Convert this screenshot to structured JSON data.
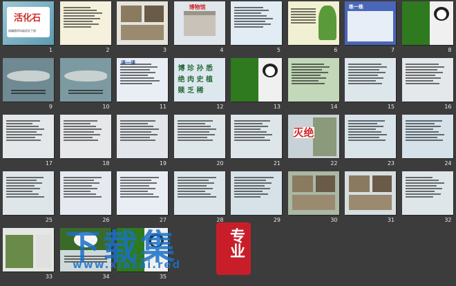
{
  "slides": [
    {
      "n": "1",
      "title": "活化石",
      "sub": "部编版四年级语文下册"
    },
    {
      "n": "2"
    },
    {
      "n": "3"
    },
    {
      "n": "4",
      "title": "博物馆"
    },
    {
      "n": "5"
    },
    {
      "n": "6"
    },
    {
      "n": "7",
      "title": "练一练"
    },
    {
      "n": "8"
    },
    {
      "n": "9"
    },
    {
      "n": "10"
    },
    {
      "n": "11",
      "title": "读一读"
    },
    {
      "n": "12",
      "chars": "博 珍 孙 悉 绝 肉 史 植 赎 乏 稀"
    },
    {
      "n": "13"
    },
    {
      "n": "14"
    },
    {
      "n": "15"
    },
    {
      "n": "16"
    },
    {
      "n": "17"
    },
    {
      "n": "18"
    },
    {
      "n": "19"
    },
    {
      "n": "20"
    },
    {
      "n": "21"
    },
    {
      "n": "22",
      "title": "灭绝"
    },
    {
      "n": "23"
    },
    {
      "n": "24"
    },
    {
      "n": "25"
    },
    {
      "n": "26"
    },
    {
      "n": "27"
    },
    {
      "n": "28"
    },
    {
      "n": "29"
    },
    {
      "n": "30"
    },
    {
      "n": "31"
    },
    {
      "n": "32"
    },
    {
      "n": "33"
    },
    {
      "n": "34"
    },
    {
      "n": "35"
    }
  ],
  "watermark": {
    "main": "下载集",
    "badge": "专业",
    "url": "www.xiazai.red"
  }
}
